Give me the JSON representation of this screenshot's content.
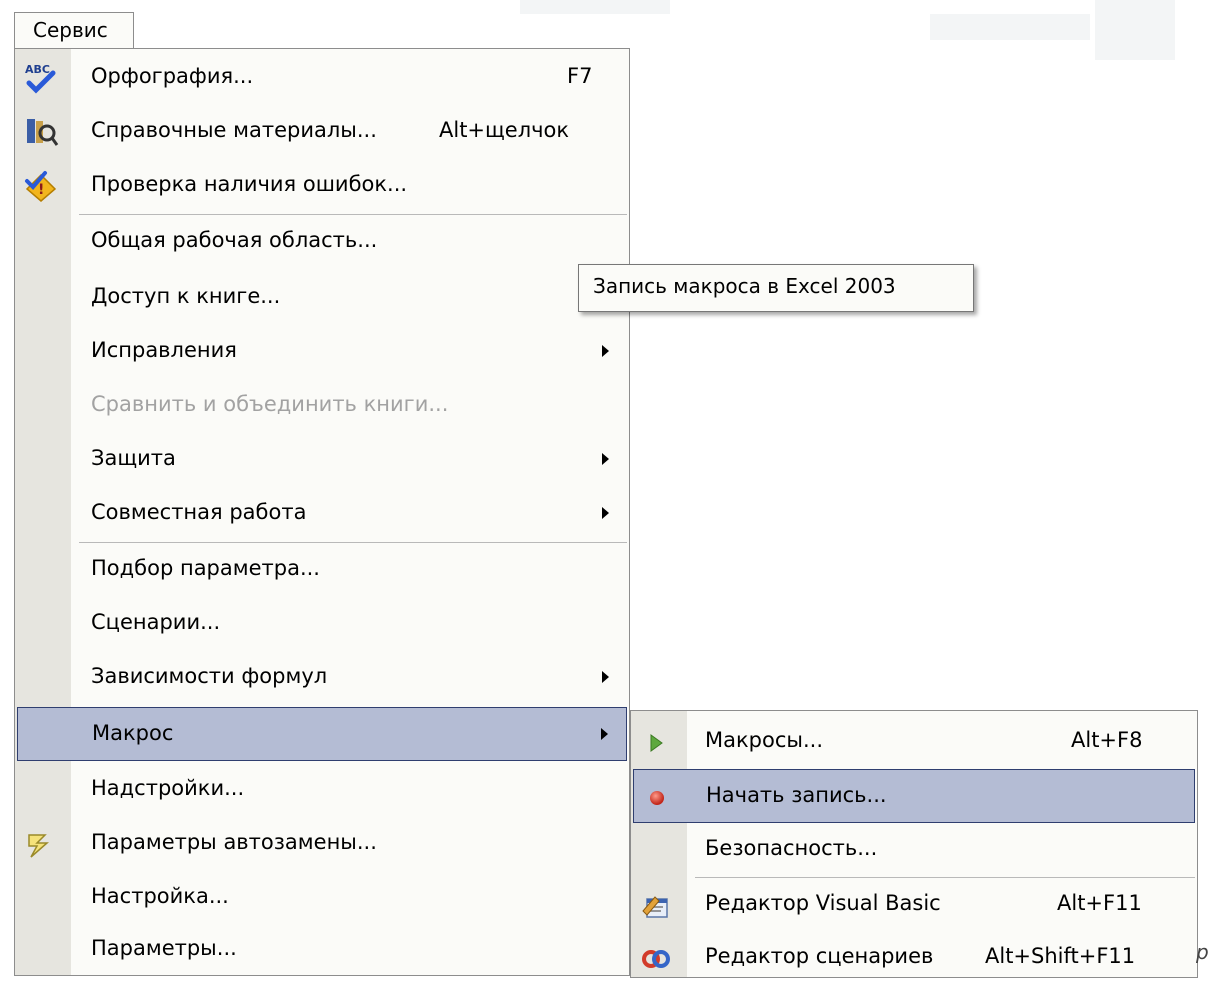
{
  "menubar": {
    "label": "Сервис"
  },
  "tooltip": {
    "text": "Запись макроса в Excel 2003"
  },
  "menu": {
    "items": [
      {
        "label": "Орфография...",
        "shortcut": "F7",
        "icon": "spelling-abc-icon"
      },
      {
        "label": "Справочные материалы...",
        "shortcut": "Alt+щелчок",
        "icon": "research-books-icon"
      },
      {
        "label": "Проверка наличия ошибок...",
        "icon": "error-check-icon"
      },
      {
        "label": "Общая рабочая область..."
      },
      {
        "label": "Доступ к книге..."
      },
      {
        "label": "Исправления",
        "submenu": true
      },
      {
        "label": "Сравнить и объединить книги...",
        "disabled": true
      },
      {
        "label": "Защита",
        "submenu": true
      },
      {
        "label": "Совместная работа",
        "submenu": true
      },
      {
        "label": "Подбор параметра..."
      },
      {
        "label": "Сценарии..."
      },
      {
        "label": "Зависимости формул",
        "submenu": true
      },
      {
        "label": "Макрос",
        "submenu": true,
        "active": true
      },
      {
        "label": "Надстройки..."
      },
      {
        "label": "Параметры автозамены...",
        "icon": "autocorrect-lightning-icon"
      },
      {
        "label": "Настройка..."
      },
      {
        "label": "Параметры..."
      }
    ]
  },
  "submenu": {
    "items": [
      {
        "label": "Макросы...",
        "shortcut": "Alt+F8",
        "icon": "run-macro-play-icon"
      },
      {
        "label": "Начать запись...",
        "icon": "record-red-dot-icon",
        "active": true
      },
      {
        "label": "Безопасность..."
      },
      {
        "label": "Редактор Visual Basic",
        "shortcut": "Alt+F11",
        "icon": "visual-basic-editor-icon"
      },
      {
        "label": "Редактор сценариев",
        "shortcut": "Alt+Shift+F11",
        "icon": "script-editor-icon"
      }
    ]
  },
  "edge_fragment": "p",
  "colors": {
    "highlight": "#b4bcd4",
    "highlight_border": "#2f3e6f",
    "icon_strip": "#e6e5df"
  }
}
